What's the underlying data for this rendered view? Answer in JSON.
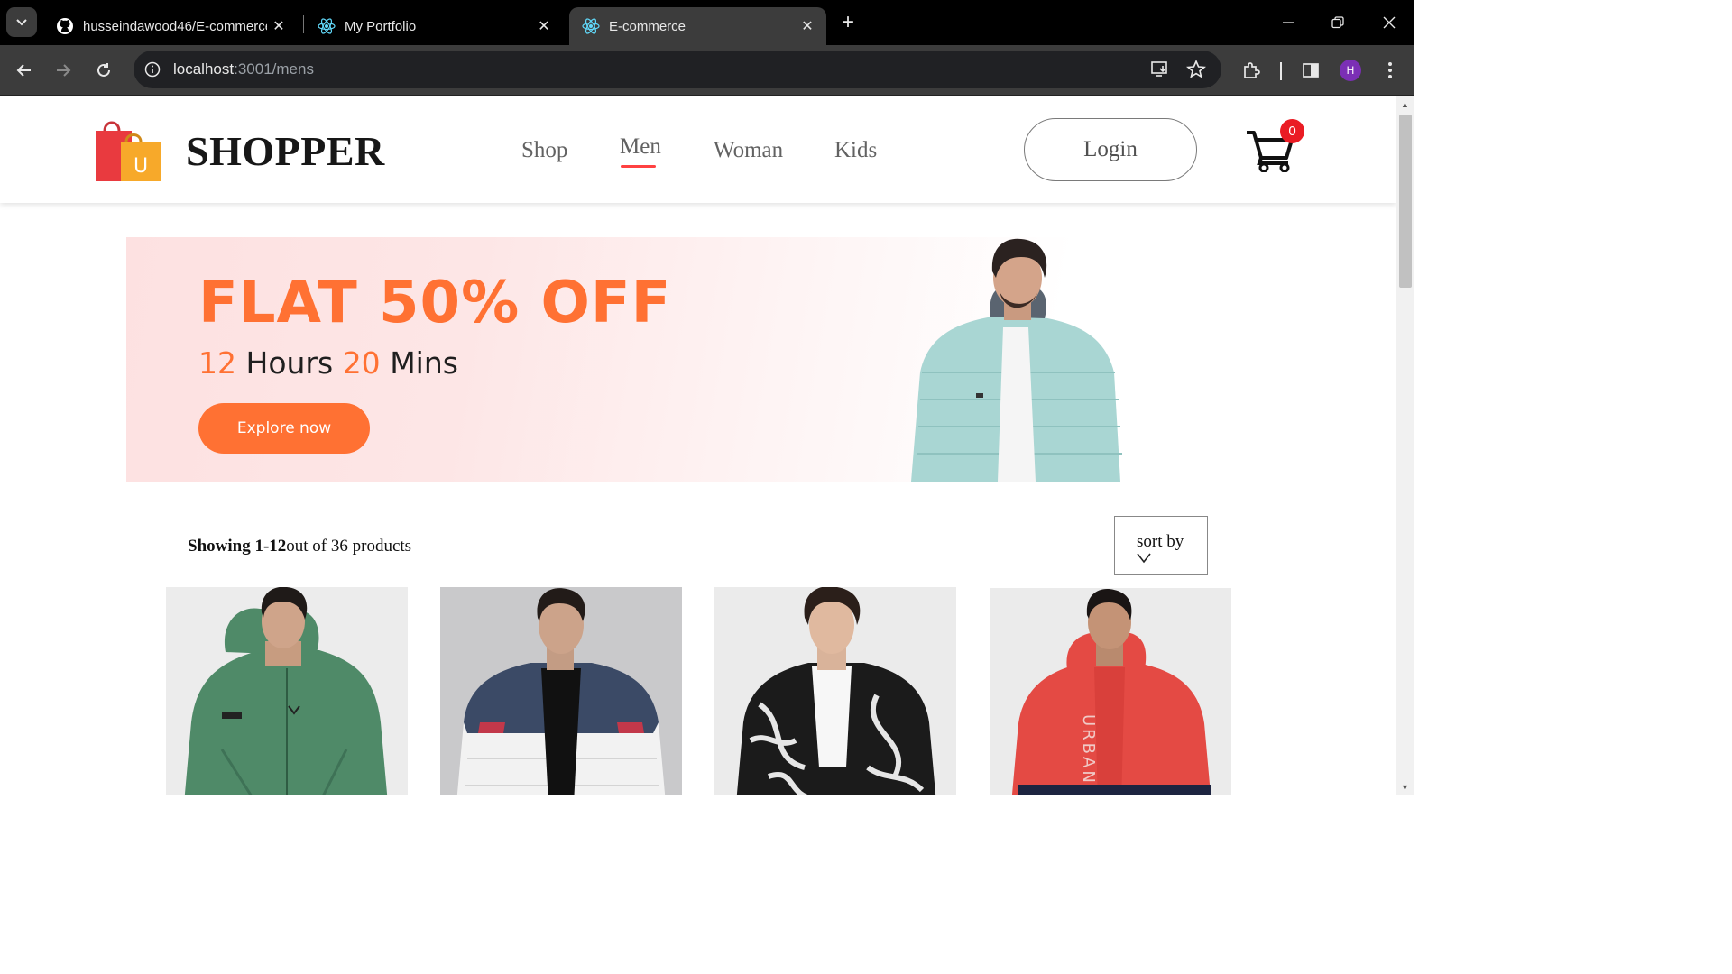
{
  "browser": {
    "tabs": [
      {
        "title": "husseindawood46/E-commerce",
        "icon": "github-icon"
      },
      {
        "title": "My Portfolio",
        "icon": "react-icon"
      },
      {
        "title": "E-commerce",
        "icon": "react-icon",
        "active": true
      }
    ],
    "url": {
      "host": "localhost",
      "rest": ":3001/mens"
    },
    "profile_initial": "H"
  },
  "site": {
    "brand": "SHOPPER",
    "nav": [
      "Shop",
      "Men",
      "Woman",
      "Kids"
    ],
    "active_nav": "Men",
    "login_label": "Login",
    "cart_count": "0"
  },
  "banner": {
    "headline": "FLAT 50% OFF",
    "hours": "12",
    "hours_label": "Hours",
    "mins": "20",
    "mins_label": "Mins",
    "cta": "Explore now"
  },
  "listing": {
    "showing_bold": "Showing 1-12",
    "showing_rest": "out of 36 products",
    "sort_label": "sort by"
  },
  "colors": {
    "accent": "#ff7133",
    "nav_underline": "#ff4141",
    "cart_badge": "#ea1c24"
  }
}
